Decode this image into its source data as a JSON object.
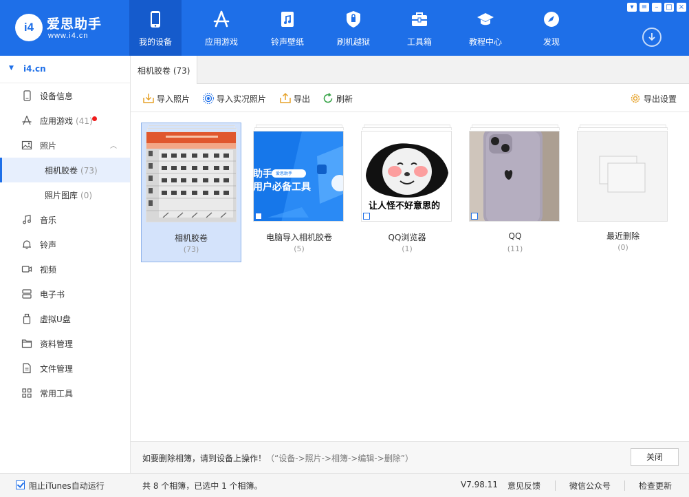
{
  "app": {
    "logo_badge": "i4",
    "logo_title": "爱思助手",
    "logo_url": "www.i4.cn"
  },
  "nav": [
    {
      "label": "我的设备",
      "icon": "phone-icon"
    },
    {
      "label": "应用游戏",
      "icon": "app-store-icon"
    },
    {
      "label": "铃声壁纸",
      "icon": "music-file-icon"
    },
    {
      "label": "刷机越狱",
      "icon": "shield-icon"
    },
    {
      "label": "工具箱",
      "icon": "toolbox-icon"
    },
    {
      "label": "教程中心",
      "icon": "graduation-cap-icon"
    },
    {
      "label": "发现",
      "icon": "compass-icon"
    }
  ],
  "sidebar": {
    "device": "i4.cn",
    "items": [
      {
        "label": "设备信息",
        "count": "",
        "icon": "device-info-icon"
      },
      {
        "label": "应用游戏",
        "count": "(41)",
        "icon": "app-store-icon"
      },
      {
        "label": "照片",
        "count": "",
        "icon": "photo-icon"
      },
      {
        "label": "相机胶卷",
        "count": "(73)",
        "icon": ""
      },
      {
        "label": "照片图库",
        "count": "(0)",
        "icon": ""
      },
      {
        "label": "音乐",
        "count": "",
        "icon": "music-note-icon"
      },
      {
        "label": "铃声",
        "count": "",
        "icon": "bell-icon"
      },
      {
        "label": "视频",
        "count": "",
        "icon": "video-icon"
      },
      {
        "label": "电子书",
        "count": "",
        "icon": "book-icon"
      },
      {
        "label": "虚拟U盘",
        "count": "",
        "icon": "usb-drive-icon"
      },
      {
        "label": "资料管理",
        "count": "",
        "icon": "folder-icon"
      },
      {
        "label": "文件管理",
        "count": "",
        "icon": "file-icon"
      },
      {
        "label": "常用工具",
        "count": "",
        "icon": "grid-icon"
      }
    ]
  },
  "tab": {
    "label": "相机胶卷 (73)"
  },
  "toolbar": {
    "import_photos": "导入照片",
    "import_live": "导入实况照片",
    "export": "导出",
    "refresh": "刷新",
    "export_settings": "导出设置"
  },
  "albums": [
    {
      "name": "相机胶卷",
      "count": "(73)"
    },
    {
      "name": "电脑导入相机胶卷",
      "count": "(5)"
    },
    {
      "name": "QQ浏览器",
      "count": "(1)"
    },
    {
      "name": "QQ",
      "count": "(11)"
    },
    {
      "name": "最近删除",
      "count": "(0)"
    }
  ],
  "thumb_text": {
    "promo_line1": "助手",
    "promo_line2": "用户必备工具",
    "search_pill": "爱思助手",
    "meme_caption": "让人怪不好意思的"
  },
  "bottom": {
    "tip_main": "如要删除相簿，请到设备上操作！",
    "tip_path": "（“设备->照片->相簿->编辑->删除”）",
    "close": "关闭"
  },
  "status": {
    "itunes": "阻止iTunes自动运行",
    "summary": "共 8 个相簿，已选中 1 个相簿。",
    "version": "V7.98.11",
    "feedback": "意见反馈",
    "wechat": "微信公众号",
    "update": "检查更新"
  },
  "colors": {
    "brand": "#1e6fe8",
    "nav_active": "#155bcc",
    "selection": "#d4e3fb",
    "badge_red": "#f01c1c"
  }
}
